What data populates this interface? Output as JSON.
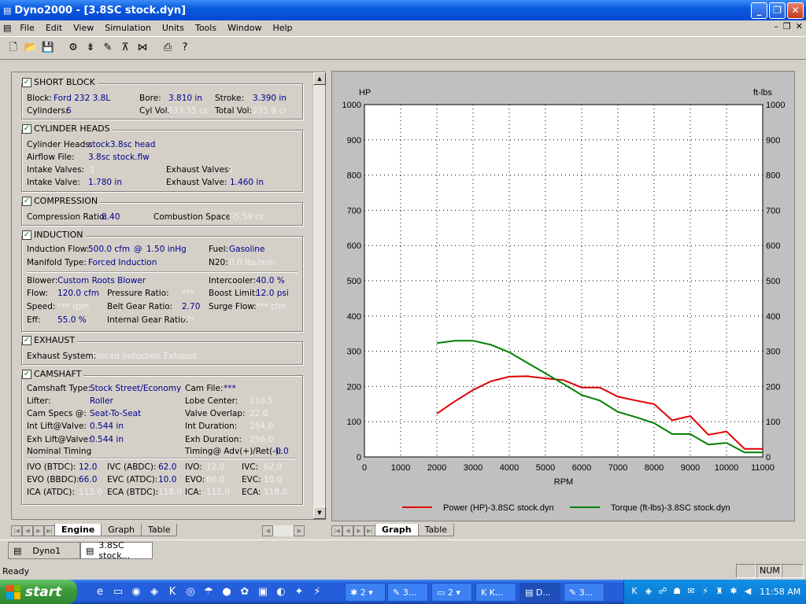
{
  "window": {
    "title": "Dyno2000 - [3.8SC stock.dyn]"
  },
  "menu": [
    "File",
    "Edit",
    "View",
    "Simulation",
    "Units",
    "Tools",
    "Window",
    "Help"
  ],
  "toolbar_icons": [
    "new-file-icon",
    "open-folder-icon",
    "save-icon",
    "engine-icon",
    "valve-icon",
    "wrench-icon",
    "cylinder-head-icon",
    "camshaft-icon",
    "print-icon",
    "help-icon"
  ],
  "short_block": {
    "title": "SHORT BLOCK",
    "block_label": "Block:",
    "block": "Ford 232 3.8L",
    "bore_label": "Bore:",
    "bore": "3.810 in",
    "stroke_label": "Stroke:",
    "stroke": "3.390 in",
    "cyl_label": "Cylinders:",
    "cylinders": "6",
    "cylvol_label": "Cyl Vol:",
    "cylvol": "633.35 cc",
    "totvol_label": "Total Vol:",
    "totvol": "231.9 ci"
  },
  "cylinder_heads": {
    "title": "CYLINDER HEADS",
    "heads_label": "Cylinder Heads:",
    "heads": "stock3.8sc head",
    "airflow_label": "Airflow File:",
    "airflow": "3.8sc stock.flw",
    "iv_label": "Intake Valves:",
    "iv": "1",
    "ev_label": "Exhaust Valves:",
    "ev": "1",
    "ivd_label": "Intake Valve:",
    "ivd": "1.780 in",
    "evd_label": "Exhaust Valve:",
    "evd": "1.460 in"
  },
  "compression": {
    "title": "COMPRESSION",
    "cr_label": "Compression Ratio:",
    "cr": "8.40",
    "cs_label": "Combustion Space:",
    "cs": "65.59 cc"
  },
  "induction": {
    "title": "INDUCTION",
    "flow_label": "Induction Flow:",
    "flow": "500.0 cfm",
    "at": "@",
    "vac": "1.50 inHg",
    "fuel_label": "Fuel:",
    "fuel": "Gasoline",
    "manifold_label": "Manifold Type:",
    "manifold": "Forced Induction",
    "n2o_label": "N20:",
    "n2o": "0.0 lbs/min",
    "blower_label": "Blower:",
    "blower": "Custom Roots Blower",
    "intercooler_label": "Intercooler:",
    "intercooler": "40.0 %",
    "bflow_label": "Flow:",
    "bflow": "120.0 cfm",
    "pr_label": "Pressure Ratio:",
    "pr": "***",
    "boost_label": "Boost Limit:",
    "boost": "12.0 psi",
    "speed_label": "Speed:",
    "speed": "*** rpm",
    "bgr_label": "Belt Gear Ratio:",
    "bgr": "2.70",
    "surge_label": "Surge Flow:",
    "surge": "*** cfm",
    "eff_label": "Eff:",
    "eff": "55.0 %",
    "igr_label": "Internal Gear Ratio:",
    "igr": "***"
  },
  "exhaust": {
    "title": "EXHAUST",
    "sys_label": "Exhaust System:",
    "sys": "Forced Induction Exhaust"
  },
  "camshaft": {
    "title": "CAMSHAFT",
    "type_label": "Camshaft Type:",
    "type": "Stock Street/Economy",
    "file_label": "Cam File:",
    "file": "***",
    "lifter_label": "Lifter:",
    "lifter": "Roller",
    "lobe_label": "Lobe Center:",
    "lobe": "116.5",
    "specs_label": "Cam Specs @:",
    "specs": "Seat-To-Seat",
    "overlap_label": "Valve Overlap:",
    "overlap": "22.0",
    "intlift_label": "Int Lift@Valve:",
    "intlift": "0.544 in",
    "intdur_label": "Int Duration:",
    "intdur": "254.0",
    "exhlift_label": "Exh Lift@Valve:",
    "exhlift": "0.544 in",
    "exhdur_label": "Exh Duration:",
    "exhdur": "256.0",
    "nominal_label": "Nominal Timing",
    "timing_label": "Timing@ Adv(+)/Ret(-):",
    "timing": "0.0",
    "ivo_btdc_label": "IVO (BTDC):",
    "ivo_btdc": "12.0",
    "ivc_abdc_label": "IVC (ABDC):",
    "ivc_abdc": "62.0",
    "ivo_label": "IVO:",
    "ivo": "12.0",
    "ivc_label": "IVC:",
    "ivc": "62.0",
    "evo_bbdc_label": "EVO (BBDC):",
    "evo_bbdc": "66.0",
    "evc_atdc_label": "EVC (ATDC):",
    "evc_atdc": "10.0",
    "evo_label": "EVO:",
    "evo": "66.0",
    "evc_label": "EVC:",
    "evc": "10.0",
    "ica_atdc_label": "ICA (ATDC):",
    "ica_atdc": "115.0",
    "eca_btdc_label": "ECA (BTDC):",
    "eca_btdc": "118.0",
    "ica_label": "ICA:",
    "ica": "115.0",
    "eca_label": "ECA:",
    "eca": "118.0"
  },
  "left_tabs": [
    "Engine",
    "Graph",
    "Table"
  ],
  "right_tabs": [
    "Graph",
    "Table"
  ],
  "doc_tabs": [
    "Dyno1",
    "3.8SC stock..."
  ],
  "status": {
    "text": "Ready",
    "num": "NUM"
  },
  "taskbar": {
    "start": "start",
    "buttons": [
      "2",
      "3...",
      "2",
      "K...",
      "D...",
      "3..."
    ],
    "clock": "11:58 AM"
  },
  "chart_data": {
    "type": "line",
    "left_axis_label": "HP",
    "right_axis_label": "ft-lbs",
    "xlabel": "RPM",
    "xlim": [
      0,
      11000
    ],
    "ylim": [
      0,
      1000
    ],
    "x_ticks": [
      0,
      1000,
      2000,
      3000,
      4000,
      5000,
      6000,
      7000,
      8000,
      9000,
      10000,
      11000
    ],
    "y_ticks": [
      0,
      100,
      200,
      300,
      400,
      500,
      600,
      700,
      800,
      900,
      1000
    ],
    "grid": true,
    "legend_position": "bottom",
    "series": [
      {
        "name": "Power (HP)-3.8SC stock.dyn",
        "color": "#e00000",
        "x": [
          2000,
          2500,
          3000,
          3500,
          4000,
          4500,
          5000,
          5500,
          6000,
          6500,
          7000,
          7500,
          8000,
          8500,
          9000,
          9500,
          10000,
          10500,
          11000
        ],
        "values": [
          123,
          158,
          190,
          215,
          228,
          229,
          223,
          218,
          197,
          197,
          171,
          160,
          150,
          104,
          116,
          63,
          72,
          23,
          23
        ]
      },
      {
        "name": "Torque (ft-lbs)-3.8SC stock.dyn",
        "color": "#008000",
        "x": [
          2000,
          2500,
          3000,
          3500,
          4000,
          4500,
          5000,
          5500,
          6000,
          6500,
          7000,
          7500,
          8000,
          8500,
          9000,
          9500,
          10000,
          10500,
          11000
        ],
        "values": [
          323,
          330,
          330,
          318,
          297,
          267,
          237,
          207,
          176,
          160,
          128,
          113,
          96,
          65,
          65,
          35,
          40,
          13,
          13
        ]
      }
    ]
  }
}
